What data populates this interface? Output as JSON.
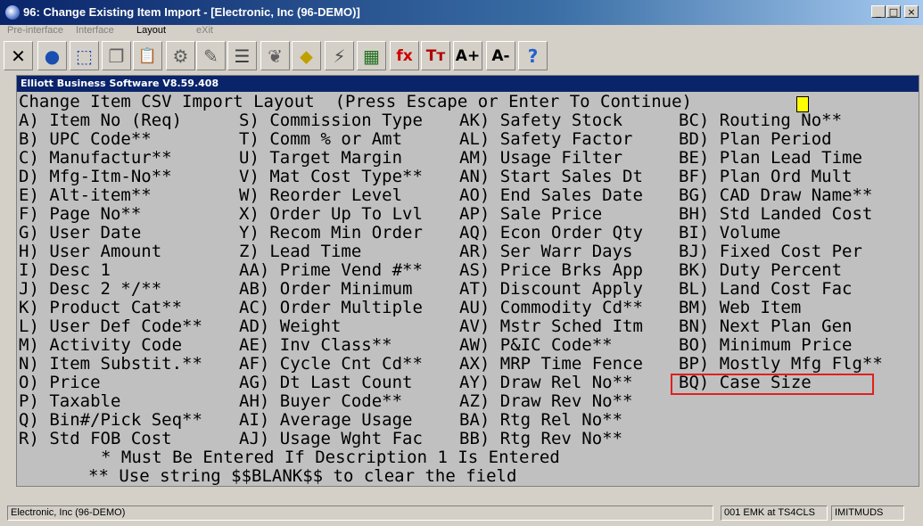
{
  "window": {
    "title": "96: Change Existing Item Import - [Electronic, Inc (96-DEMO)]",
    "min": "_",
    "max": "□",
    "close": "×"
  },
  "menu": [
    {
      "label": "Pre-interface",
      "disabled": true
    },
    {
      "label": "Interface",
      "disabled": true
    },
    {
      "label": "Layout",
      "disabled": false
    },
    {
      "label": "eXit",
      "disabled": true
    }
  ],
  "toolbar": [
    {
      "icon": "close-x-icon",
      "glyph": "✕",
      "color": "#000000"
    },
    {
      "icon": "globe-icon",
      "glyph": "●",
      "color": "#1a4fb0"
    },
    {
      "icon": "select-box-icon",
      "glyph": "⬚",
      "color": "#2040c0"
    },
    {
      "icon": "copy-icon",
      "glyph": "❐",
      "color": "#606060"
    },
    {
      "icon": "paste-icon",
      "glyph": "📋",
      "color": "#806000"
    },
    {
      "icon": "gear-icon",
      "glyph": "⚙",
      "color": "#606060"
    },
    {
      "icon": "edit-icon",
      "glyph": "✎",
      "color": "#606060"
    },
    {
      "icon": "list-icon",
      "glyph": "☰",
      "color": "#404040"
    },
    {
      "icon": "users-icon",
      "glyph": "❦",
      "color": "#606060"
    },
    {
      "icon": "tag-icon",
      "glyph": "⬥",
      "color": "#c0a000"
    },
    {
      "icon": "lightning-icon",
      "glyph": "⚡",
      "color": "#505050"
    },
    {
      "icon": "calendar-icon",
      "glyph": "▦",
      "color": "#207020"
    },
    {
      "icon": "function-icon",
      "glyph": "fx",
      "color": "#d00000"
    },
    {
      "icon": "text-format-icon",
      "glyph": "Tт",
      "color": "#b00000"
    },
    {
      "icon": "font-increase-icon",
      "glyph": "A+",
      "color": "#000000"
    },
    {
      "icon": "font-decrease-icon",
      "glyph": "A-",
      "color": "#000000"
    },
    {
      "icon": "help-icon",
      "glyph": "?",
      "color": "#2060d0"
    }
  ],
  "inner_title": "Elliott Business Software V8.59.408",
  "screen": {
    "header": "Change Item CSV Import Layout  (Press Escape or Enter To Continue)",
    "col1": [
      "A) Item No (Req)",
      "B) UPC Code**",
      "C) Manufactur**",
      "D) Mfg-Itm-No**",
      "E) Alt-item**",
      "F) Page No**",
      "G) User Date",
      "H) User Amount",
      "I) Desc 1",
      "J) Desc 2 */**",
      "K) Product Cat**",
      "L) User Def Code**",
      "M) Activity Code",
      "N) Item Substit.**",
      "O) Price",
      "P) Taxable",
      "Q) Bin#/Pick Seq**",
      "R) Std FOB Cost"
    ],
    "col2": [
      "S) Commission Type",
      "T) Comm % or Amt",
      "U) Target Margin",
      "V) Mat Cost Type**",
      "W) Reorder Level",
      "X) Order Up To Lvl",
      "Y) Recom Min Order",
      "Z) Lead Time",
      "AA) Prime Vend #**",
      "AB) Order Minimum",
      "AC) Order Multiple",
      "AD) Weight",
      "AE) Inv Class**",
      "AF) Cycle Cnt Cd**",
      "AG) Dt Last Count",
      "AH) Buyer Code**",
      "AI) Average Usage",
      "AJ) Usage Wght Fac"
    ],
    "col3": [
      "AK) Safety Stock",
      "AL) Safety Factor",
      "AM) Usage Filter",
      "AN) Start Sales Dt",
      "AO) End Sales Date",
      "AP) Sale Price",
      "AQ) Econ Order Qty",
      "AR) Ser Warr Days",
      "AS) Price Brks App",
      "AT) Discount Apply",
      "AU) Commodity Cd**",
      "AV) Mstr Sched Itm",
      "AW) P&IC Code**",
      "AX) MRP Time Fence",
      "AY) Draw Rel No**",
      "AZ) Draw Rev No**",
      "BA) Rtg Rel No**",
      "BB) Rtg Rev No**"
    ],
    "col4": [
      "BC) Routing No**",
      "BD) Plan Period",
      "BE) Plan Lead Time",
      "BF) Plan Ord Mult",
      "BG) CAD Draw Name**",
      "BH) Std Landed Cost",
      "BI) Volume",
      "BJ) Fixed Cost Per",
      "BK) Duty Percent",
      "BL) Land Cost Fac",
      "BM) Web Item",
      "BN) Next Plan Gen",
      "BO) Minimum Price",
      "BP) Mostly Mfg Flg**",
      "BQ) Case Size"
    ],
    "footnote1": "* Must Be Entered If Description 1 Is Entered",
    "footnote2": "** Use string $$BLANK$$ to clear the field"
  },
  "status": {
    "company": "Electronic, Inc (96-DEMO)",
    "user": "001 EMK at TS4CLS",
    "program": "IMITMUDS"
  },
  "colors": {
    "highlight": "#e02020",
    "cursor": "#ffff00",
    "terminal_bg": "#c0c0c0"
  }
}
